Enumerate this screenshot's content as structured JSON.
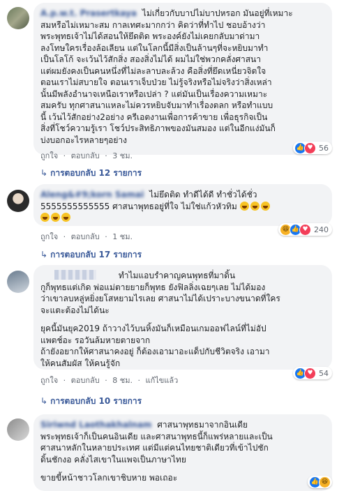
{
  "comments": [
    {
      "author": "A.p.w.t. Prasertkaya",
      "lines": [
        "ไม่เกี่ยวกับบาปไม่บาปหรอก มันอยู่ที่เหมาะ",
        "สมหรือไม่เหมาะสม กาลเทศะมากกว่า คิดว่าที่ทำไป ชอบอ้างว่า",
        "พระพุทธเจ้าไม่ได้สอนให้ยึดติด พระองค์ยังไม่เคยกลับมาด่ามา",
        "ลงโทษใครเรื่องล้อเลียน แต่ในโลกนี้มีสิ่งเป็นล้านๆที่จะหยิบมาทำ",
        "เป็นโลโก้ จะเว้นไว้สักสิ่ง สองสิ่งไม่ได้ ผมไม่ใช่พวกคลั่งศาสนา",
        "แต่ผมยังคงเป็นคนหนึ่งที่ไม่ละลาบละล้วง คือสิ่งที่ยึดเหนี่ยวจิตใจ",
        "ตอนเราไม่สบายใจ ตอนเราเจ็บป่วย ไม่รู้จริงหรือไม่จริงว่าสิ่งเหล่า",
        "นั้นมีพลังอำนาจเหนือเราหรือเปล่า ? แต่มันเป็นเรื่องความเหมาะ",
        "สมครับ ทุกศาสนาแหละไม่ควรหยิบจับมาทำเรื่องตลก หรือทำแบบ",
        "นี้ เว้นไว้สักอย่าง2อย่าง ครีเอตงานเพื่อการค้าขาย เพื่อธุรกิจเป็น",
        "สิ่งที่โชว์ความรู้เรา โชว์ประสิทธิภาพของมันสมอง แต่ในอีกแง่มันก็",
        "บ่งบอกอะไรหลายๆอย่าง"
      ],
      "like_label": "ถูกใจ",
      "reply_label": "ตอบกลับ",
      "time": "3 ชม.",
      "reaction_count": "56",
      "replies_text": "การตอบกลับ 12 รายการ"
    },
    {
      "author": "Aleng&#9;korn Samai",
      "lines": [
        "ไม่ยึดติด ทำดีได้ดี ทำชั่วได้ชั่ว",
        "5555555555555 ศาสนาพุทธอยู่ที่ใจ ไม่ใช่แก้วหัวทิม"
      ],
      "like_label": "ถูกใจ",
      "reply_label": "ตอบกลับ",
      "time": "1 ชม.",
      "reaction_count": "240",
      "replies_text": "การตอบกลับ 17 รายการ"
    },
    {
      "author": "",
      "lines": [
        "ทำไมแอบรำคาญคนพุทธที่มาดิ้น",
        "กูก็พุทธแต่เกิด พ่อแม่ตายยายก็พุทธ ยังฟิลลิ่งเฉยๆเลย ไม่ได้มอง",
        "ว่าเขาลบหลู่หยิ่งยโสหยามไรเลย ศาสนาไม่ได้เปราะบางขนาดที่ใคร",
        "จะแตะต้องไม่ได้นะ"
      ],
      "lines2": [
        "ยุคนี้มันยุค2019 ถ้าวางไว้บนหิ้งมันก็เหมือนเกมออฟไลน์ที่ไม่อัป",
        "แพตช์อะ รอวันล้มหายตายจาก",
        "ถ้ายังอยากให้ศาสนาคงอยู่ ก็ต้องเอามาอะแด็ปกับชีวิตจริง เอามา",
        "ให้คนสัมผัส ให้คนรู้จัก"
      ],
      "like_label": "ถูกใจ",
      "reply_label": "ตอบกลับ",
      "time": "8 ชม.",
      "edited_label": "แก้ไขแล้ว",
      "reaction_count": "54",
      "replies_text": "การตอบกลับ 10 รายการ"
    },
    {
      "author": "Siriwnd Laothakhalnam",
      "lines": [
        "ศาสนาพุทธมาจากอินเดีย",
        "พระพุทธเจ้าก็เป็นคนอินเดีย และศาสนาพุทธนี้ก็แพร่หลายและเป็น",
        "ศาสนาหลักในหลายประเทศ แต่มีแต่คนไทยชาติเดียวที่เข้าไปชัก",
        "ดิ้นชักงอ คลั่งไสเขาในแพจเป็นภาษาไทย"
      ],
      "lines2": [
        "ขายขี้หน้าชาวโลกเขาชิบหาย พอเถอะ"
      ]
    }
  ],
  "separator": "·",
  "reply_arrow": "↳",
  "colors": {
    "link": "#385898",
    "bubble": "#f2f3f5",
    "meta": "#616770"
  },
  "icons": {
    "like": "like-icon",
    "heart": "heart-icon",
    "haha": "haha-icon"
  }
}
